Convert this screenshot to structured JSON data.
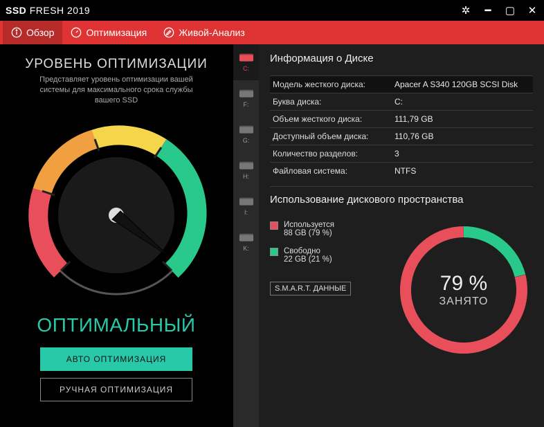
{
  "window": {
    "title_bold": "SSD",
    "title_rest": "FRESH 2019"
  },
  "tabs": {
    "overview": "Обзор",
    "optimize": "Оптимизация",
    "live": "Живой-Анализ"
  },
  "left": {
    "title": "УРОВЕНЬ ОПТИМИЗАЦИИ",
    "desc": "Представляет уровень оптимизации вашей системы для максимального срока службы вашего SSD",
    "status": "ОПТИМАЛЬНЫЙ",
    "auto_btn": "АВТО ОПТИМИЗАЦИЯ",
    "manual_btn": "РУЧНАЯ ОПТИМИЗАЦИЯ"
  },
  "drives": {
    "list": [
      "C:",
      "F:",
      "G:",
      "H:",
      "I:",
      "K:"
    ],
    "active_index": 0
  },
  "info": {
    "section_title": "Информация о Диске",
    "rows": [
      {
        "label": "Модель жесткого диска:",
        "value": "Apacer A S340 120GB SCSI Disk",
        "highlight": true
      },
      {
        "label": "Буква диска:",
        "value": "C:"
      },
      {
        "label": "Объем жесткого диска:",
        "value": "111,79   GB"
      },
      {
        "label": "Доступный объем диска:",
        "value": "110,76   GB"
      },
      {
        "label": "Количество разделов:",
        "value": "3"
      },
      {
        "label": "Файловая система:",
        "value": "NTFS"
      }
    ]
  },
  "usage": {
    "section_title": "Использование дискового пространства",
    "used_label": "Используется",
    "used_value": "88 GB (79 %)",
    "free_label": "Свободно",
    "free_value": "22 GB (21 %)",
    "smart": "S.M.A.R.T. ДАННЫЕ",
    "percent": "79 %",
    "percent_label": "ЗАНЯТО"
  },
  "chart_data": [
    {
      "type": "pie",
      "title": "Использование дискового пространства",
      "series": [
        {
          "name": "Используется",
          "value": 79,
          "unit": "%",
          "gb": 88,
          "color": "#e84f5a"
        },
        {
          "name": "Свободно",
          "value": 21,
          "unit": "%",
          "gb": 22,
          "color": "#28c98a"
        }
      ],
      "center_label": "79 % ЗАНЯТО"
    },
    {
      "type": "other",
      "title": "Уровень оптимизации (gauge)",
      "range": [
        0,
        100
      ],
      "value_estimate": 85,
      "segments": [
        "red",
        "orange",
        "yellow",
        "green"
      ]
    }
  ]
}
